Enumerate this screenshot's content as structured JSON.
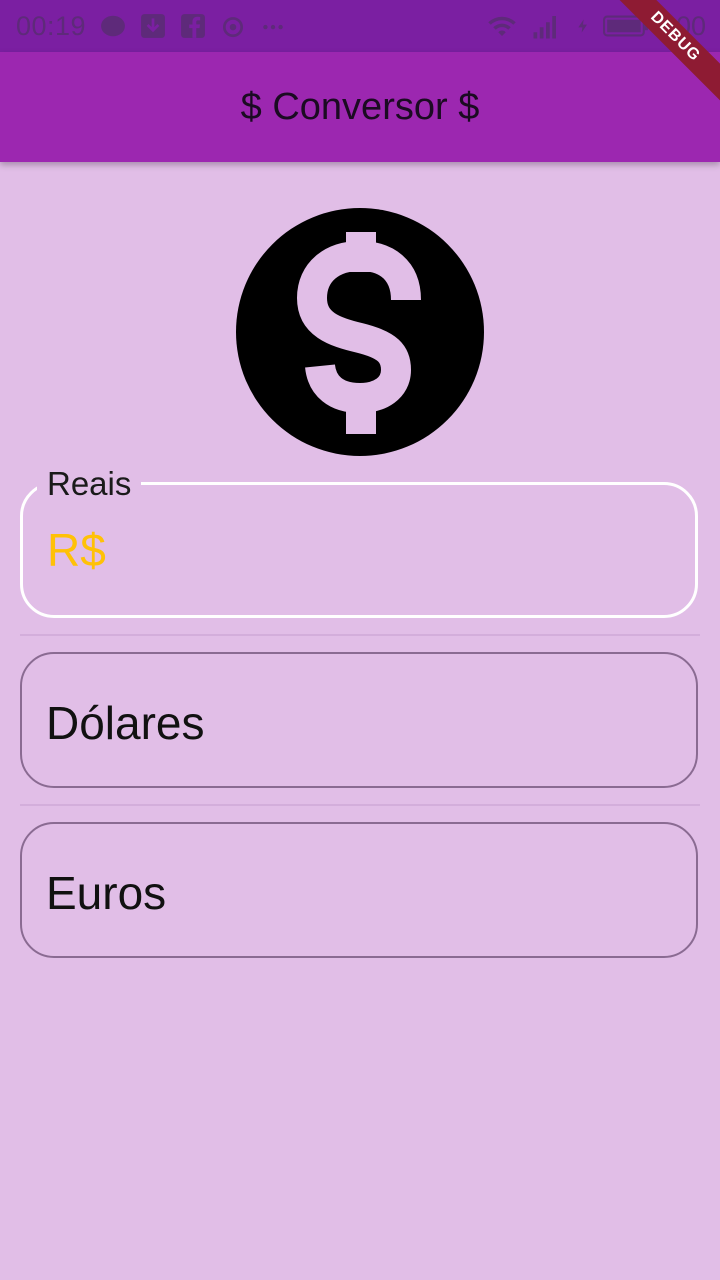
{
  "status_bar": {
    "time": "00:19",
    "battery": "100",
    "icons": [
      "messenger-icon",
      "download-icon",
      "facebook-icon",
      "android-icon",
      "more-icon",
      "wifi-icon",
      "signal-icon",
      "charging-icon",
      "battery-icon"
    ]
  },
  "debug_banner": "DEBUG",
  "app_bar": {
    "title": "$ Conversor $"
  },
  "coin_icon": "dollar-coin-icon",
  "fields": {
    "reais": {
      "label": "Reais",
      "prefix": "R$"
    },
    "dolares": {
      "label": "Dólares"
    },
    "euros": {
      "label": "Euros"
    }
  },
  "colors": {
    "status_bar": "#7B1FA2",
    "app_bar": "#9C27B0",
    "background": "#E1BEE7",
    "prefix": "#FFC107",
    "debug": "#8E1B33"
  }
}
